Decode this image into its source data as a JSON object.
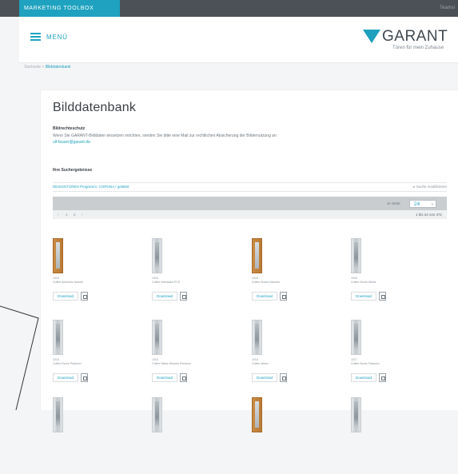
{
  "topbar": {
    "tab_label": "MARKETING TOOLBOX",
    "right_text": "Teamsi"
  },
  "header": {
    "menu_label": "MENÜ",
    "logo_name": "GARANT",
    "tagline": "Türen für mein Zuhause"
  },
  "breadcrumb": {
    "home": "Startseite",
    "separator": ">",
    "current": "Bilddatenbank"
  },
  "page": {
    "title": "Bilddatenbank",
    "notice_title": "Bildrechteschutz",
    "notice_text": "Wenn Sie GARANT-Bilddaten einsetzen möchten, senden Sie bitte eine Mail zur rechtlichen Absicherung der Bildernutzung an",
    "notice_email": "ulf.fauser@garant.de.",
    "results_title": "Ihre Suchergebnisse"
  },
  "filter": {
    "active": "DESIGNTÜREN Programm: CORONA / geklebt",
    "modify": "▸ Suche modifizieren"
  },
  "pager": {
    "per_page_label": "Je Seite:",
    "per_page_value": "24",
    "pages": [
      "‹",
      "1",
      "2",
      "›"
    ],
    "count": "1 bis 24 von 471"
  },
  "products": [
    {
      "code": "1016",
      "name": "Coffee Authentic Naturel",
      "download": "Download"
    },
    {
      "code": "1016",
      "name": "Coffee Weisslack PCS",
      "download": "Download"
    },
    {
      "code": "1016",
      "name": "Coffee Buche Dekoren",
      "download": "Download"
    },
    {
      "code": "1016",
      "name": "Coffee Esche Weiss",
      "download": "Download"
    },
    {
      "code": "1016",
      "name": "Coffee Esche Platinum",
      "download": "Download"
    },
    {
      "code": "1016",
      "name": "Coffee Weiss Struktur Premium",
      "download": "Download"
    },
    {
      "code": "1016",
      "name": "Coffee Weiss",
      "download": "Download"
    },
    {
      "code": "1017",
      "name": "Coffee Esche Platinum",
      "download": "Download"
    }
  ],
  "colors": {
    "accent": "#1ea2bf",
    "topbar": "#4c5157",
    "background": "#f4f5f6"
  }
}
